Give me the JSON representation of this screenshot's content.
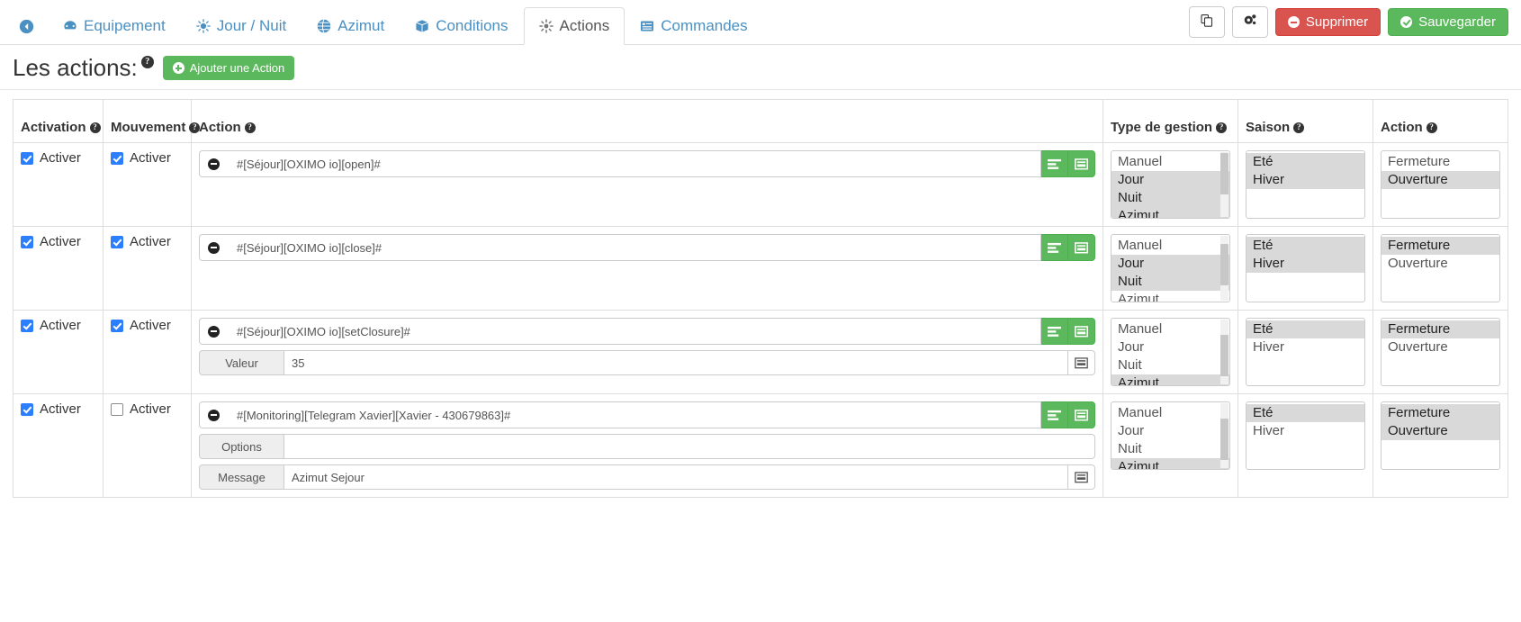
{
  "nav": {
    "back_icon": "back-arrow-icon",
    "tabs": [
      {
        "label": "Equipement",
        "icon": "equipment-icon",
        "active": false
      },
      {
        "label": "Jour / Nuit",
        "icon": "sun-icon",
        "active": false
      },
      {
        "label": "Azimut",
        "icon": "globe-icon",
        "active": false
      },
      {
        "label": "Conditions",
        "icon": "box-icon",
        "active": false
      },
      {
        "label": "Actions",
        "icon": "gear-sun-icon",
        "active": true
      },
      {
        "label": "Commandes",
        "icon": "list-icon",
        "active": false
      }
    ],
    "buttons": {
      "duplicate": "",
      "configure": "",
      "delete": "Supprimer",
      "save": "Sauvegarder"
    }
  },
  "page": {
    "title": "Les actions:",
    "help": "?",
    "add_button": "Ajouter une Action"
  },
  "table": {
    "headers": {
      "activation": "Activation",
      "mouvement": "Mouvement",
      "action": "Action",
      "type_gestion": "Type de gestion",
      "saison": "Saison",
      "action2": "Action"
    },
    "checkbox_label": "Activer",
    "type_options": [
      "Manuel",
      "Jour",
      "Nuit",
      "Azimut"
    ],
    "saison_options": [
      "Eté",
      "Hiver"
    ],
    "action_options": [
      "Fermeture",
      "Ouverture"
    ],
    "rows": [
      {
        "activation_checked": true,
        "mouvement_checked": true,
        "expression": "#[Séjour][OXIMO io][open]#",
        "subfields": [],
        "type_selected": [
          "Jour",
          "Nuit",
          "Azimut"
        ],
        "saison_selected": [
          "Eté",
          "Hiver"
        ],
        "action_selected": [
          "Ouverture"
        ]
      },
      {
        "activation_checked": true,
        "mouvement_checked": true,
        "expression": "#[Séjour][OXIMO io][close]#",
        "subfields": [],
        "type_selected": [
          "Jour",
          "Nuit"
        ],
        "saison_selected": [
          "Eté",
          "Hiver"
        ],
        "action_selected": [
          "Fermeture"
        ]
      },
      {
        "activation_checked": true,
        "mouvement_checked": true,
        "expression": "#[Séjour][OXIMO io][setClosure]#",
        "subfields": [
          {
            "label": "Valeur",
            "value": "35",
            "has_button": true
          }
        ],
        "type_selected": [
          "Azimut"
        ],
        "saison_selected": [
          "Eté"
        ],
        "action_selected": [
          "Fermeture"
        ]
      },
      {
        "activation_checked": true,
        "mouvement_checked": false,
        "expression": "#[Monitoring][Telegram Xavier][Xavier - 430679863]#",
        "subfields": [
          {
            "label": "Options",
            "value": "",
            "has_button": false
          },
          {
            "label": "Message",
            "value": "Azimut Sejour",
            "has_button": true
          }
        ],
        "type_selected": [
          "Azimut"
        ],
        "saison_selected": [
          "Eté"
        ],
        "action_selected": [
          "Fermeture",
          "Ouverture"
        ]
      }
    ]
  },
  "colors": {
    "accent": "#4a90c2",
    "danger": "#d9534f",
    "success": "#5cb85c",
    "selected_bg": "#d9d9d9"
  }
}
